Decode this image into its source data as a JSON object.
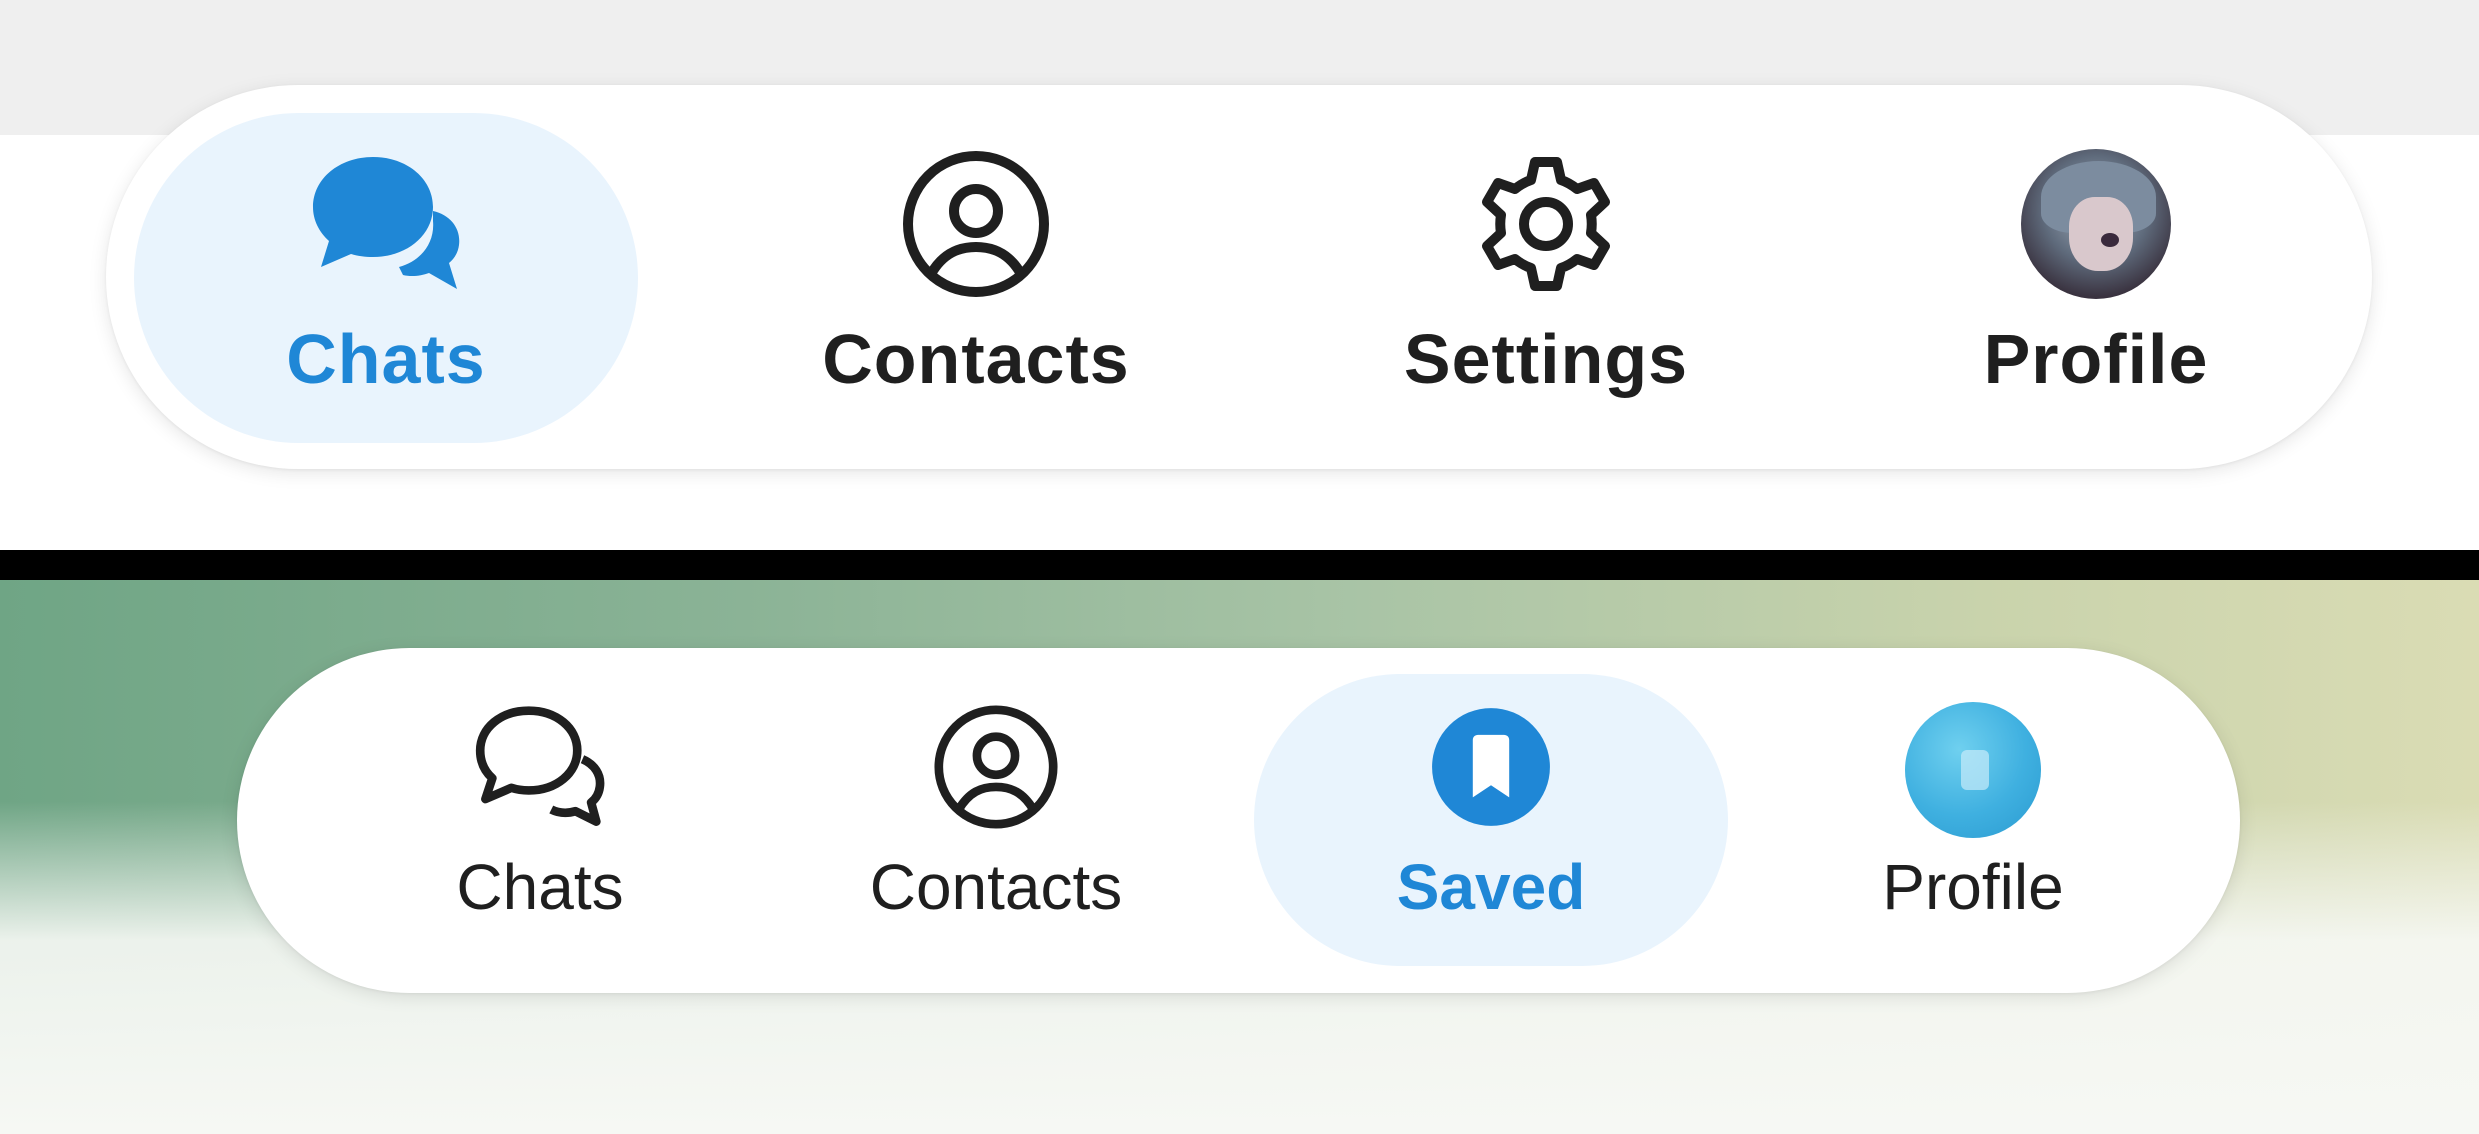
{
  "top_bar": {
    "tabs": [
      {
        "label": "Chats",
        "icon": "chat-bubbles-filled-icon",
        "active": true
      },
      {
        "label": "Contacts",
        "icon": "person-circle-icon",
        "active": false
      },
      {
        "label": "Settings",
        "icon": "gear-icon",
        "active": false
      },
      {
        "label": "Profile",
        "icon": "avatar-anime-icon",
        "active": false
      }
    ]
  },
  "bottom_bar": {
    "tabs": [
      {
        "label": "Chats",
        "icon": "chat-bubbles-outline-icon",
        "active": false
      },
      {
        "label": "Contacts",
        "icon": "person-circle-icon",
        "active": false
      },
      {
        "label": "Saved",
        "icon": "bookmark-circle-icon",
        "active": true
      },
      {
        "label": "Profile",
        "icon": "avatar-blue-icon",
        "active": false
      }
    ]
  },
  "colors": {
    "accent": "#1f87d6",
    "active_pill": "#e9f4fd",
    "text": "#1f1f1f",
    "divider": "#000000"
  }
}
